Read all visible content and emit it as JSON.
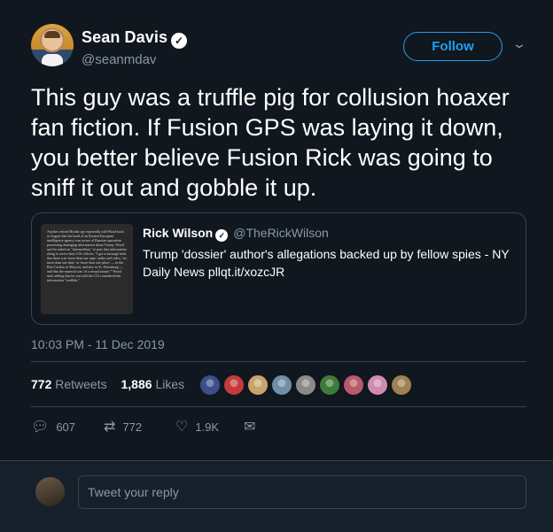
{
  "author": {
    "name": "Sean Davis",
    "handle": "@seanmdav",
    "verified_glyph": "✓"
  },
  "follow_label": "Follow",
  "tweet": {
    "text": "This guy was a truffle pig for collusion hoaxer fan fiction. If Fusion GPS was laying it down, you better believe Fusion Rick was going to sniff it out and gobble it up."
  },
  "quoted": {
    "name": "Rick Wilson",
    "handle": "@TheRickWilson",
    "text": "Trump 'dossier' author's allegations backed up by fellow spies - NY Daily News pllqt.it/xozcJR",
    "thumbnail_text": "Another retired British spy reportedly told Wood back in August that the head of an Eastern European intelligence agency was aware of Russian operatives possessing damaging information about Trump. Wood said he asked an \"intermediary\" to pass that information along to active duty CIA officers. \"I got a message back that there was 'more than one tape,' audio and video, 'on more than one date,' in 'more than one place' — in the Ritz-Carlton in Moscow and also in St. Petersburg — and that the material was 'of a sexual nature,'\" Wood said, adding that he was told the CIA considered the information \"credible.\""
  },
  "timestamp": "10:03 PM - 11 Dec 2019",
  "stats": {
    "retweets_count": "772",
    "retweets_label": "Retweets",
    "likes_count": "1,886",
    "likes_label": "Likes"
  },
  "likers_colors": [
    "#3b4f8c",
    "#c43b3b",
    "#c9a46a",
    "#6f8fa6",
    "#8a8a8a",
    "#3f7a3a",
    "#b85a6a",
    "#d08ab0",
    "#a08055"
  ],
  "actions": {
    "replies": "607",
    "retweets": "772",
    "likes": "1.9K"
  },
  "reply": {
    "placeholder": "Tweet your reply"
  }
}
